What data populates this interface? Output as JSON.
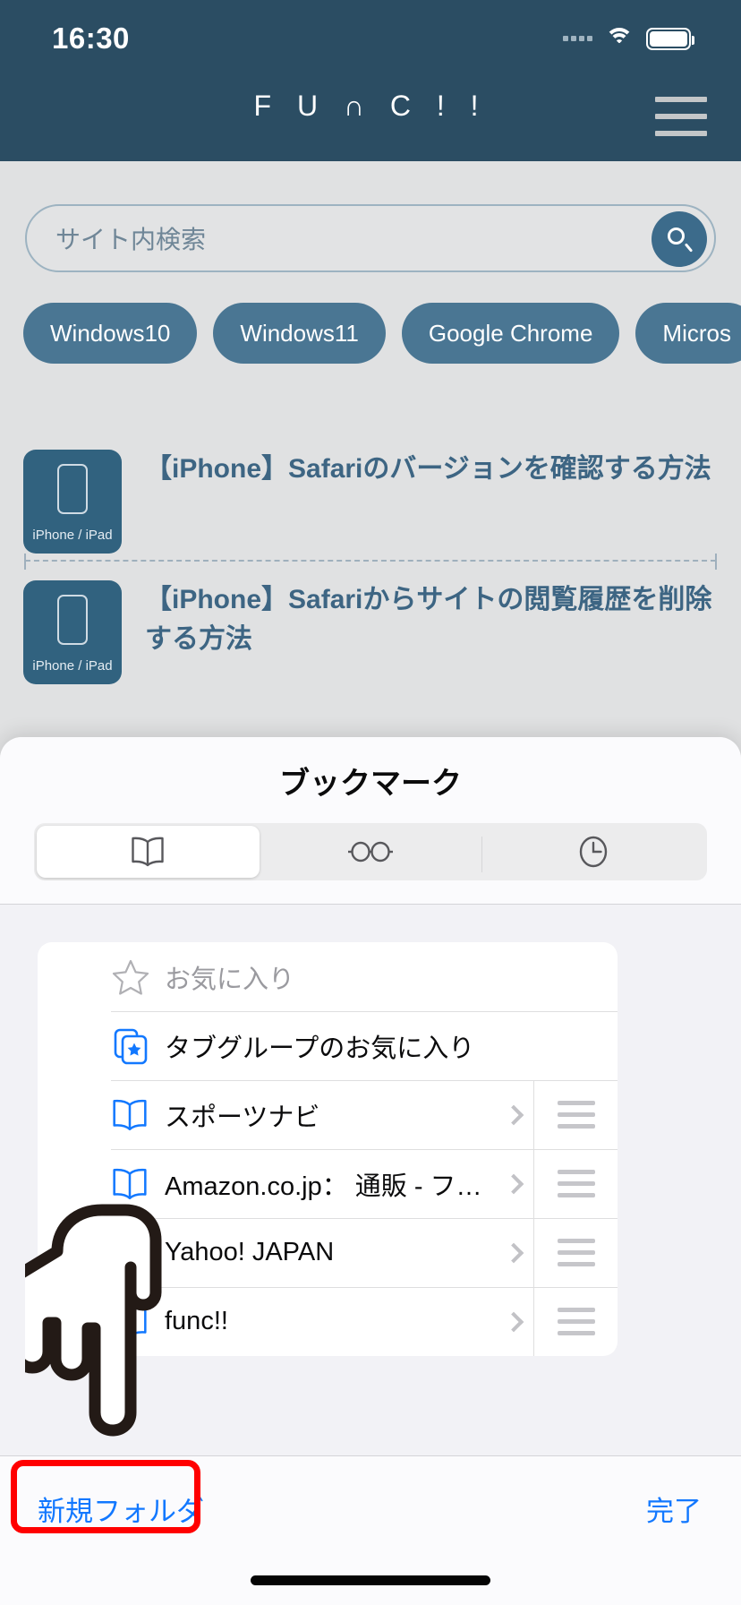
{
  "status_bar": {
    "time": "16:30",
    "signal_icon": "cellular-signal-icon",
    "wifi_icon": "wifi-icon",
    "battery_icon": "battery-icon"
  },
  "site": {
    "brand": "F U ∩ C ! !",
    "menu_icon": "hamburger-menu-icon",
    "search": {
      "placeholder": "サイト内検索",
      "value": "",
      "button_icon": "search-icon"
    },
    "tags": [
      "Windows10",
      "Windows11",
      "Google Chrome",
      "Micros"
    ],
    "articles": [
      {
        "thumb_caption": "iPhone / iPad",
        "title": "【iPhone】Safariのバージョンを確認する方法"
      },
      {
        "thumb_caption": "iPhone / iPad",
        "title": "【iPhone】Safariからサイトの閲覧履歴を削除する方法"
      }
    ]
  },
  "sheet": {
    "title": "ブックマーク",
    "tabs": [
      {
        "name": "bookmarks",
        "icon": "book-icon",
        "selected": true
      },
      {
        "name": "reading-list",
        "icon": "glasses-icon",
        "selected": false
      },
      {
        "name": "history",
        "icon": "clock-icon",
        "selected": false
      }
    ],
    "rows": [
      {
        "label": "お気に入り",
        "icon": "star-outline-icon",
        "muted": true,
        "deletable": false,
        "has_chevron": false,
        "has_reorder": false
      },
      {
        "label": "タブグループのお気に入り",
        "icon": "tab-group-favorites-icon",
        "muted": false,
        "deletable": false,
        "has_chevron": false,
        "has_reorder": false
      },
      {
        "label": "スポーツナビ",
        "icon": "book-blue-icon",
        "muted": false,
        "deletable": true,
        "has_chevron": true,
        "has_reorder": true
      },
      {
        "label": "Amazon.co.jp： 通販 - フ…",
        "icon": "book-blue-icon",
        "muted": false,
        "deletable": true,
        "has_chevron": true,
        "has_reorder": true
      },
      {
        "label": "Yahoo! JAPAN",
        "icon": "book-blue-icon",
        "muted": false,
        "deletable": true,
        "has_chevron": true,
        "has_reorder": true
      },
      {
        "label": "func!!",
        "icon": "book-blue-icon",
        "muted": false,
        "deletable": true,
        "has_chevron": true,
        "has_reorder": true
      }
    ],
    "toolbar": {
      "new_folder_label": "新規フォルダ",
      "done_label": "完了"
    }
  },
  "annotation": {
    "highlight_color": "#ff0000",
    "pointer_icon": "pointing-hand-icon",
    "target": "新規フォルダ"
  },
  "colors": {
    "header_bg": "#2b4d63",
    "page_bg": "#e0e1e2",
    "accent_blue": "#1278ff",
    "delete_red": "#fd2015",
    "annotation_red": "#ff0000"
  }
}
